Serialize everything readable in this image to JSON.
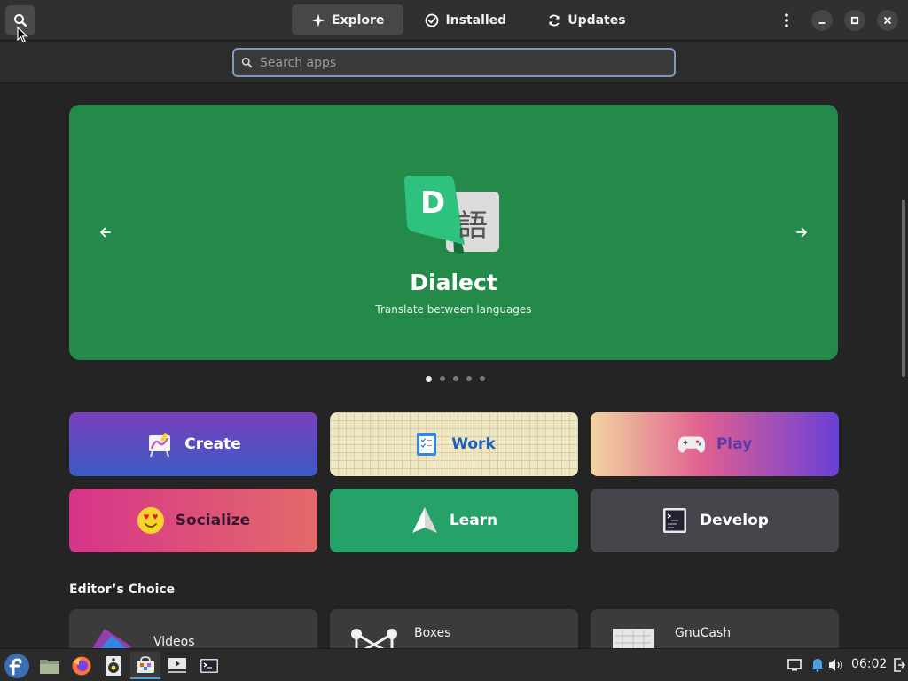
{
  "header": {
    "tabs": [
      {
        "label": "Explore",
        "icon": "explore-icon",
        "active": true
      },
      {
        "label": "Installed",
        "icon": "installed-check-icon",
        "active": false
      },
      {
        "label": "Updates",
        "icon": "updates-refresh-icon",
        "active": false
      }
    ],
    "icons": [
      "search-icon",
      "menu-kebab-icon",
      "minimize-icon",
      "maximize-icon",
      "close-icon"
    ]
  },
  "search": {
    "placeholder": "Search apps",
    "value": ""
  },
  "featured": {
    "title": "Dialect",
    "subtitle": "Translate between languages",
    "icon_letter": "D",
    "icon_glyph": "語",
    "background": "#248a4a",
    "pages": 5,
    "active_page": 1
  },
  "categories": [
    {
      "label": "Create",
      "icon": "create-easel-icon"
    },
    {
      "label": "Work",
      "icon": "work-clipboard-icon"
    },
    {
      "label": "Play",
      "icon": "play-gamepad-icon"
    },
    {
      "label": "Socialize",
      "icon": "socialize-emoji-icon"
    },
    {
      "label": "Learn",
      "icon": "learn-paper-plane-icon"
    },
    {
      "label": "Develop",
      "icon": "develop-terminal-icon"
    }
  ],
  "editors_choice": {
    "title": "Editor’s Choice",
    "apps": [
      {
        "name": "Videos"
      },
      {
        "name": "Boxes"
      },
      {
        "name": "GnuCash"
      }
    ]
  },
  "taskbar": {
    "clock": "06:02",
    "apps": [
      "fedora-logo-icon",
      "files-icon",
      "firefox-icon",
      "rhythmbox-icon",
      "software-icon",
      "video-player-icon",
      "terminal-icon"
    ],
    "tray": [
      "network-icon",
      "notification-bell-icon",
      "volume-icon",
      "logout-icon"
    ]
  },
  "colors": {
    "accent": "#7f9ac0",
    "featured_green": "#248a4a",
    "learn_green": "#26a269",
    "develop_gray": "#45454b"
  }
}
